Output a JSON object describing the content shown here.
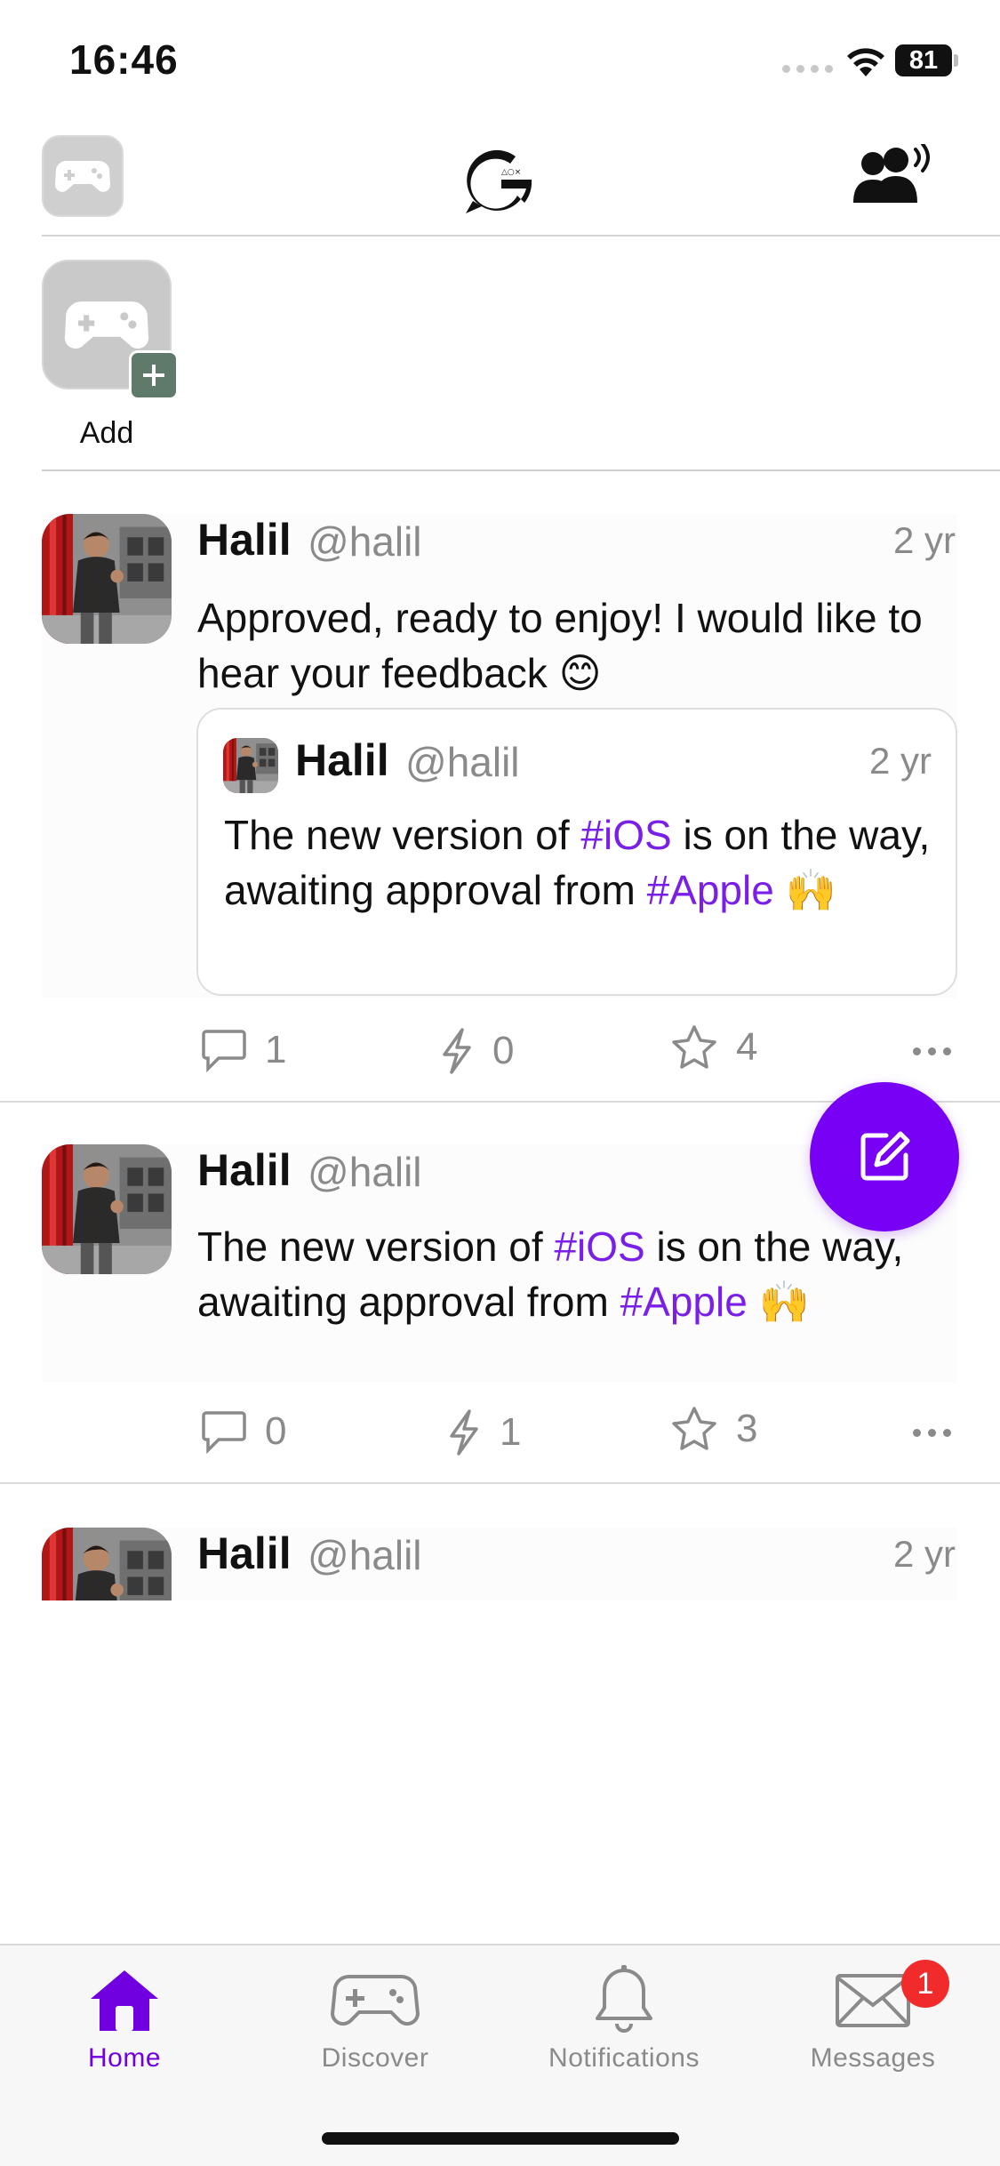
{
  "status_bar": {
    "time": "16:46",
    "battery": "81"
  },
  "header": {
    "logo_icon": "g-chat-logo-icon",
    "left_icon": "gamepad-icon",
    "right_icon": "people-broadcast-icon"
  },
  "stories": {
    "add_label": "Add"
  },
  "posts": [
    {
      "name": "Halil",
      "handle": "@halil",
      "time": "2 yr",
      "text": "Approved, ready to enjoy! I would like to hear your feedback 😊",
      "quote": {
        "name": "Halil",
        "handle": "@halil",
        "time": "2 yr",
        "text_parts": [
          "The new version of ",
          "#iOS",
          " is on the way, awaiting approval from ",
          "#Apple",
          " 🙌"
        ]
      },
      "comments": "1",
      "boosts": "0",
      "stars": "4"
    },
    {
      "name": "Halil",
      "handle": "@halil",
      "text_parts": [
        "The new version of ",
        "#iOS",
        " is on the way, awaiting approval from ",
        "#Apple",
        " 🙌"
      ],
      "comments": "0",
      "boosts": "1",
      "stars": "3"
    },
    {
      "name": "Halil",
      "handle": "@halil",
      "time": "2 yr"
    }
  ],
  "tabs": [
    {
      "label": "Home",
      "icon": "home-icon",
      "active": true
    },
    {
      "label": "Discover",
      "icon": "gamepad-icon"
    },
    {
      "label": "Notifications",
      "icon": "bell-icon"
    },
    {
      "label": "Messages",
      "icon": "envelope-icon",
      "badge": "1"
    }
  ],
  "colors": {
    "accent": "#7800f5",
    "hashtag": "#7a1fe8",
    "badge": "#f12b2b"
  }
}
